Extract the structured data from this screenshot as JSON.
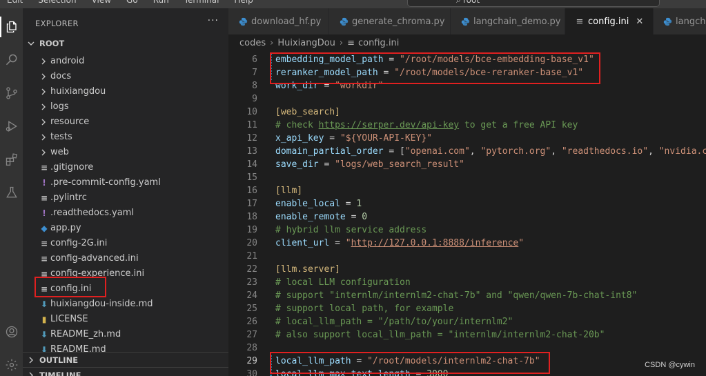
{
  "menu": [
    "Edit",
    "Selection",
    "View",
    "Go",
    "Run",
    "Terminal",
    "Help"
  ],
  "command_center": {
    "text": "root"
  },
  "sidebar": {
    "title": "EXPLORER",
    "more": "···",
    "root_label": "ROOT",
    "items": [
      {
        "label": "android",
        "kind": "folder"
      },
      {
        "label": "docs",
        "kind": "folder"
      },
      {
        "label": "huixiangdou",
        "kind": "folder"
      },
      {
        "label": "logs",
        "kind": "folder"
      },
      {
        "label": "resource",
        "kind": "folder"
      },
      {
        "label": "tests",
        "kind": "folder"
      },
      {
        "label": "web",
        "kind": "folder"
      },
      {
        "label": ".gitignore",
        "kind": "config"
      },
      {
        "label": ".pre-commit-config.yaml",
        "kind": "yaml"
      },
      {
        "label": ".pylintrc",
        "kind": "config"
      },
      {
        "label": ".readthedocs.yaml",
        "kind": "yaml"
      },
      {
        "label": "app.py",
        "kind": "python"
      },
      {
        "label": "config-2G.ini",
        "kind": "config"
      },
      {
        "label": "config-advanced.ini",
        "kind": "config"
      },
      {
        "label": "config-experience.ini",
        "kind": "config"
      },
      {
        "label": "config.ini",
        "kind": "config"
      },
      {
        "label": "huixiangdou-inside.md",
        "kind": "markdown"
      },
      {
        "label": "LICENSE",
        "kind": "license"
      },
      {
        "label": "README_zh.md",
        "kind": "markdown"
      },
      {
        "label": "README.md",
        "kind": "markdown"
      }
    ],
    "outline_label": "OUTLINE",
    "timeline_label": "TIMELINE"
  },
  "tabs": [
    {
      "label": "download_hf.py",
      "icon": "python-icon",
      "active": false
    },
    {
      "label": "generate_chroma.py",
      "icon": "python-icon",
      "active": false
    },
    {
      "label": "langchain_demo.py",
      "icon": "python-icon",
      "active": false
    },
    {
      "label": "config.ini",
      "icon": "config-icon",
      "active": true,
      "close": "✕"
    },
    {
      "label": "langcha",
      "icon": "python-icon",
      "active": false
    }
  ],
  "breadcrumb": {
    "parts": [
      "codes",
      "HuixiangDou",
      "config.ini"
    ]
  },
  "editor": {
    "lines": [
      {
        "num": "6",
        "tokens": [
          [
            "k",
            "embedding_model_path"
          ],
          [
            "p",
            " = "
          ],
          [
            "s",
            "\"/root/models/bce-embedding-base_v1\""
          ]
        ]
      },
      {
        "num": "7",
        "tokens": [
          [
            "k",
            "reranker_model_path"
          ],
          [
            "p",
            " = "
          ],
          [
            "s",
            "\"/root/models/bce-reranker-base_v1\""
          ]
        ]
      },
      {
        "num": "8",
        "tokens": [
          [
            "k",
            "work_dir"
          ],
          [
            "p",
            " = "
          ],
          [
            "s",
            "\"workdir\""
          ]
        ]
      },
      {
        "num": "9",
        "tokens": []
      },
      {
        "num": "10",
        "tokens": [
          [
            "sec-h",
            "[web_search]"
          ]
        ]
      },
      {
        "num": "11",
        "tokens": [
          [
            "c",
            "# check "
          ],
          [
            "c u",
            "https://serper.dev/api-key"
          ],
          [
            "c",
            " to get a free API key"
          ]
        ]
      },
      {
        "num": "12",
        "tokens": [
          [
            "k",
            "x_api_key"
          ],
          [
            "p",
            " = "
          ],
          [
            "s",
            "\"${YOUR-API-KEY}\""
          ]
        ]
      },
      {
        "num": "13",
        "tokens": [
          [
            "k",
            "domain_partial_order"
          ],
          [
            "p",
            " = ["
          ],
          [
            "s",
            "\"openai.com\""
          ],
          [
            "p",
            ", "
          ],
          [
            "s",
            "\"pytorch.org\""
          ],
          [
            "p",
            ", "
          ],
          [
            "s",
            "\"readthedocs.io\""
          ],
          [
            "p",
            ", "
          ],
          [
            "s",
            "\"nvidia.co"
          ]
        ]
      },
      {
        "num": "14",
        "tokens": [
          [
            "k",
            "save_dir"
          ],
          [
            "p",
            " = "
          ],
          [
            "s",
            "\"logs/web_search_result\""
          ]
        ]
      },
      {
        "num": "15",
        "tokens": []
      },
      {
        "num": "16",
        "tokens": [
          [
            "sec-h",
            "[llm]"
          ]
        ]
      },
      {
        "num": "17",
        "tokens": [
          [
            "k",
            "enable_local"
          ],
          [
            "p",
            " = "
          ],
          [
            "n",
            "1"
          ]
        ]
      },
      {
        "num": "18",
        "tokens": [
          [
            "k",
            "enable_remote"
          ],
          [
            "p",
            " = "
          ],
          [
            "n",
            "0"
          ]
        ]
      },
      {
        "num": "19",
        "tokens": [
          [
            "c",
            "# hybrid llm service address"
          ]
        ]
      },
      {
        "num": "20",
        "tokens": [
          [
            "k",
            "client_url"
          ],
          [
            "p",
            " = "
          ],
          [
            "s",
            "\""
          ],
          [
            "s u",
            "http://127.0.0.1:8888/inference"
          ],
          [
            "s",
            "\""
          ]
        ]
      },
      {
        "num": "21",
        "tokens": []
      },
      {
        "num": "22",
        "tokens": [
          [
            "sec-h",
            "[llm.server]"
          ]
        ]
      },
      {
        "num": "23",
        "tokens": [
          [
            "c",
            "# local LLM configuration"
          ]
        ]
      },
      {
        "num": "24",
        "tokens": [
          [
            "c",
            "# support \"internlm/internlm2-chat-7b\" and \"qwen/qwen-7b-chat-int8\""
          ]
        ]
      },
      {
        "num": "25",
        "tokens": [
          [
            "c",
            "# support local path, for example"
          ]
        ]
      },
      {
        "num": "26",
        "tokens": [
          [
            "c",
            "# local_llm_path = \"/path/to/your/internlm2\""
          ]
        ]
      },
      {
        "num": "27",
        "tokens": [
          [
            "c",
            "# also support local_llm_path = \"internlm/internlm2-chat-20b\""
          ]
        ]
      },
      {
        "num": "28",
        "tokens": []
      },
      {
        "num": "29",
        "tokens": [
          [
            "k",
            "local_llm_path"
          ],
          [
            "p",
            " = "
          ],
          [
            "s",
            "\"/root/models/internlm2-chat-7b\""
          ]
        ]
      },
      {
        "num": "30",
        "tokens": [
          [
            "k",
            "local_llm_max_text_length"
          ],
          [
            "p",
            " = "
          ],
          [
            "n",
            "3000"
          ]
        ]
      }
    ]
  },
  "watermark": "CSDN @cywin"
}
